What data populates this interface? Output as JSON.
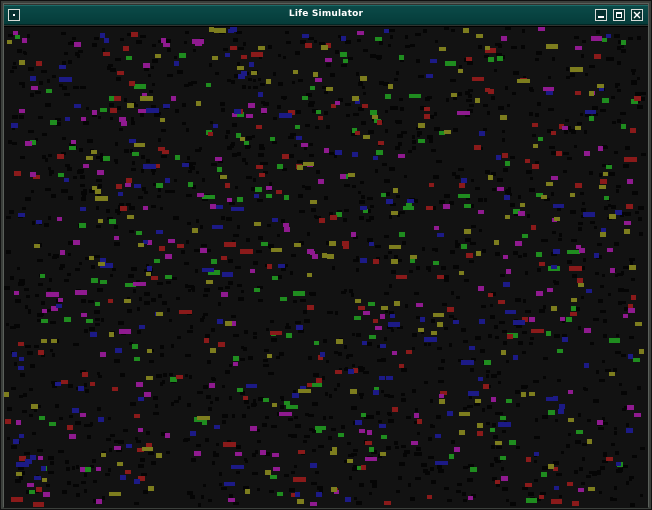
{
  "window": {
    "title": "Life Simulator",
    "menu_icon": "window-menu-icon",
    "minimize_icon": "minimize-icon",
    "maximize_icon": "maximize-icon",
    "close_icon": "close-icon"
  },
  "simulation": {
    "background_color": "#121212",
    "shadow_color": "#050505",
    "species": [
      {
        "name": "green",
        "color": "#1f8c1f"
      },
      {
        "name": "red",
        "color": "#8a1a1a"
      },
      {
        "name": "purple",
        "color": "#8f1a8f"
      },
      {
        "name": "blue",
        "color": "#1c1a86"
      },
      {
        "name": "olive",
        "color": "#7d7d1e"
      }
    ],
    "population_per_species": 150,
    "shadow_count": 1400
  }
}
